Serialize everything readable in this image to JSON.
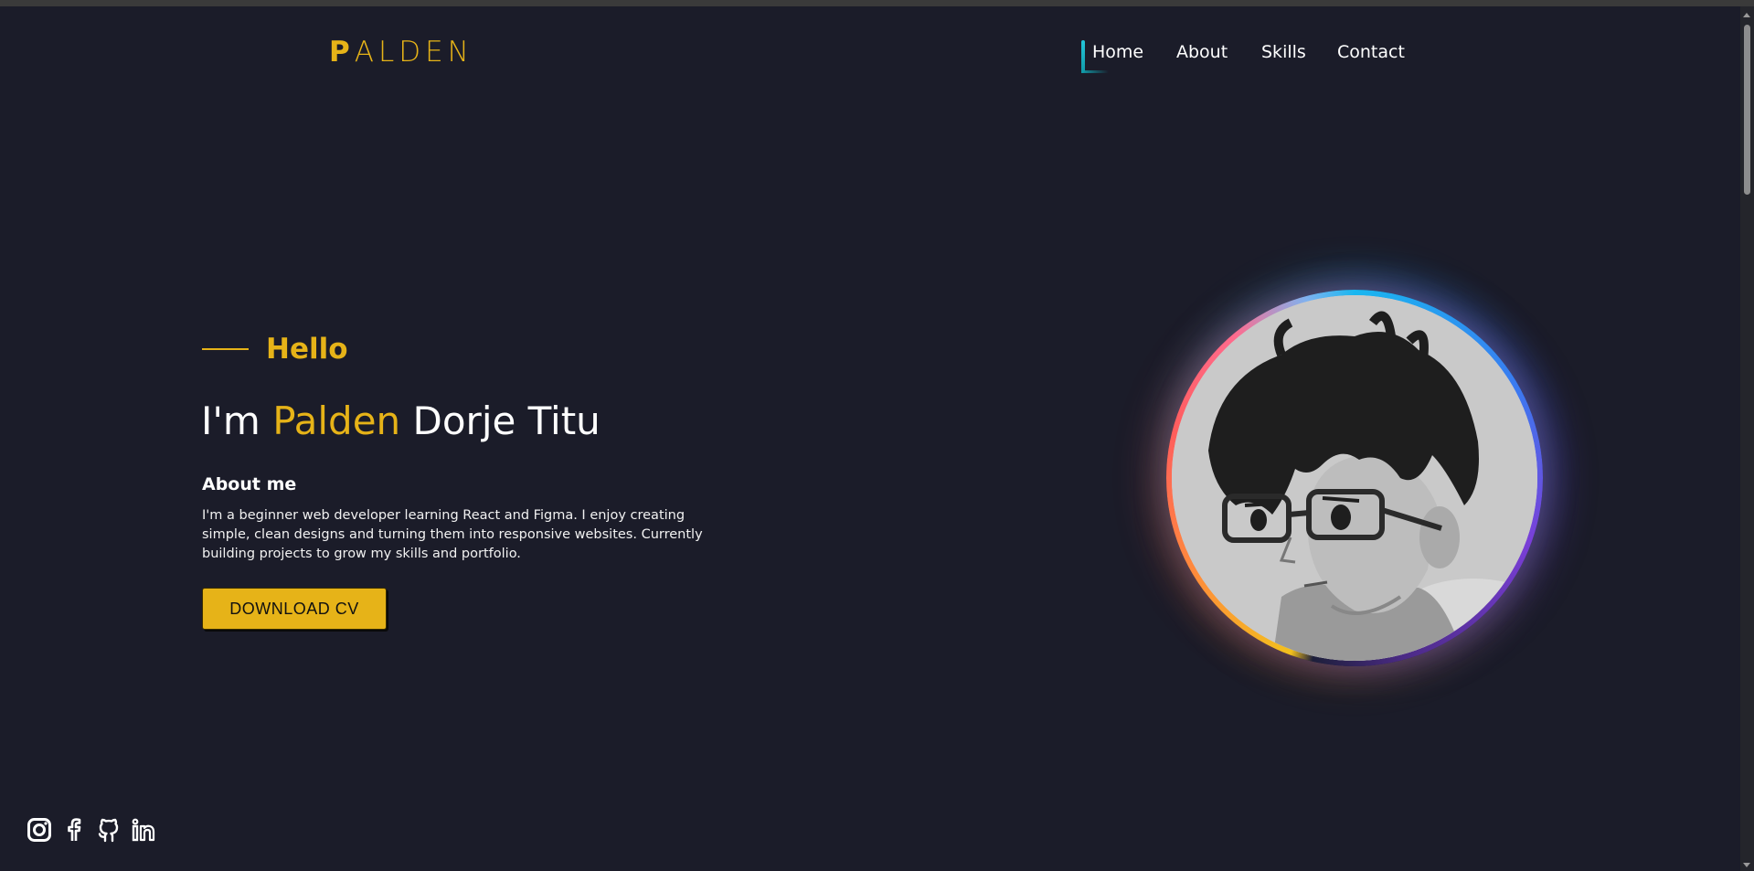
{
  "logo": {
    "first_letter": "P",
    "rest": "ALDEN"
  },
  "nav": {
    "items": [
      {
        "label": "Home"
      },
      {
        "label": "About"
      },
      {
        "label": "Skills"
      },
      {
        "label": "Contact"
      }
    ]
  },
  "hero": {
    "greeting": "Hello",
    "headline": {
      "prefix": "I'm ",
      "accent": "Palden",
      "suffix": " Dorje Titu"
    },
    "about_title": "About me",
    "about_text": "I'm a beginner web developer learning React and Figma. I enjoy creating simple, clean designs and turning them into responsive websites. Currently building projects to grow my skills and portfolio.",
    "cv_button": "DOWNLOAD CV"
  },
  "avatar": {
    "icon": "anime-portrait-avatar"
  },
  "social": [
    {
      "icon": "instagram-icon"
    },
    {
      "icon": "facebook-icon"
    },
    {
      "icon": "github-icon"
    },
    {
      "icon": "linkedin-icon"
    }
  ],
  "colors": {
    "background": "#1b1c29",
    "accent": "#e6b318",
    "nav_indicator": "#23c6d9",
    "text": "#ffffff"
  }
}
